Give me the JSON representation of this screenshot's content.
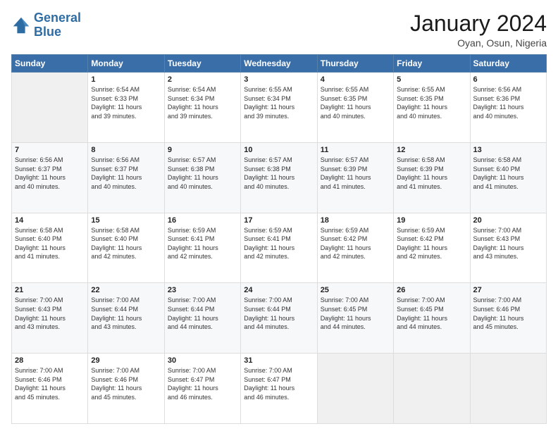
{
  "logo": {
    "line1": "General",
    "line2": "Blue"
  },
  "title": "January 2024",
  "subtitle": "Oyan, Osun, Nigeria",
  "days_of_week": [
    "Sunday",
    "Monday",
    "Tuesday",
    "Wednesday",
    "Thursday",
    "Friday",
    "Saturday"
  ],
  "weeks": [
    [
      {
        "day": "",
        "sunrise": "",
        "sunset": "",
        "daylight": ""
      },
      {
        "day": "1",
        "sunrise": "Sunrise: 6:54 AM",
        "sunset": "Sunset: 6:33 PM",
        "daylight": "Daylight: 11 hours and 39 minutes."
      },
      {
        "day": "2",
        "sunrise": "Sunrise: 6:54 AM",
        "sunset": "Sunset: 6:34 PM",
        "daylight": "Daylight: 11 hours and 39 minutes."
      },
      {
        "day": "3",
        "sunrise": "Sunrise: 6:55 AM",
        "sunset": "Sunset: 6:34 PM",
        "daylight": "Daylight: 11 hours and 39 minutes."
      },
      {
        "day": "4",
        "sunrise": "Sunrise: 6:55 AM",
        "sunset": "Sunset: 6:35 PM",
        "daylight": "Daylight: 11 hours and 40 minutes."
      },
      {
        "day": "5",
        "sunrise": "Sunrise: 6:55 AM",
        "sunset": "Sunset: 6:35 PM",
        "daylight": "Daylight: 11 hours and 40 minutes."
      },
      {
        "day": "6",
        "sunrise": "Sunrise: 6:56 AM",
        "sunset": "Sunset: 6:36 PM",
        "daylight": "Daylight: 11 hours and 40 minutes."
      }
    ],
    [
      {
        "day": "7",
        "sunrise": "Sunrise: 6:56 AM",
        "sunset": "Sunset: 6:37 PM",
        "daylight": "Daylight: 11 hours and 40 minutes."
      },
      {
        "day": "8",
        "sunrise": "Sunrise: 6:56 AM",
        "sunset": "Sunset: 6:37 PM",
        "daylight": "Daylight: 11 hours and 40 minutes."
      },
      {
        "day": "9",
        "sunrise": "Sunrise: 6:57 AM",
        "sunset": "Sunset: 6:38 PM",
        "daylight": "Daylight: 11 hours and 40 minutes."
      },
      {
        "day": "10",
        "sunrise": "Sunrise: 6:57 AM",
        "sunset": "Sunset: 6:38 PM",
        "daylight": "Daylight: 11 hours and 40 minutes."
      },
      {
        "day": "11",
        "sunrise": "Sunrise: 6:57 AM",
        "sunset": "Sunset: 6:39 PM",
        "daylight": "Daylight: 11 hours and 41 minutes."
      },
      {
        "day": "12",
        "sunrise": "Sunrise: 6:58 AM",
        "sunset": "Sunset: 6:39 PM",
        "daylight": "Daylight: 11 hours and 41 minutes."
      },
      {
        "day": "13",
        "sunrise": "Sunrise: 6:58 AM",
        "sunset": "Sunset: 6:40 PM",
        "daylight": "Daylight: 11 hours and 41 minutes."
      }
    ],
    [
      {
        "day": "14",
        "sunrise": "Sunrise: 6:58 AM",
        "sunset": "Sunset: 6:40 PM",
        "daylight": "Daylight: 11 hours and 41 minutes."
      },
      {
        "day": "15",
        "sunrise": "Sunrise: 6:58 AM",
        "sunset": "Sunset: 6:40 PM",
        "daylight": "Daylight: 11 hours and 42 minutes."
      },
      {
        "day": "16",
        "sunrise": "Sunrise: 6:59 AM",
        "sunset": "Sunset: 6:41 PM",
        "daylight": "Daylight: 11 hours and 42 minutes."
      },
      {
        "day": "17",
        "sunrise": "Sunrise: 6:59 AM",
        "sunset": "Sunset: 6:41 PM",
        "daylight": "Daylight: 11 hours and 42 minutes."
      },
      {
        "day": "18",
        "sunrise": "Sunrise: 6:59 AM",
        "sunset": "Sunset: 6:42 PM",
        "daylight": "Daylight: 11 hours and 42 minutes."
      },
      {
        "day": "19",
        "sunrise": "Sunrise: 6:59 AM",
        "sunset": "Sunset: 6:42 PM",
        "daylight": "Daylight: 11 hours and 42 minutes."
      },
      {
        "day": "20",
        "sunrise": "Sunrise: 7:00 AM",
        "sunset": "Sunset: 6:43 PM",
        "daylight": "Daylight: 11 hours and 43 minutes."
      }
    ],
    [
      {
        "day": "21",
        "sunrise": "Sunrise: 7:00 AM",
        "sunset": "Sunset: 6:43 PM",
        "daylight": "Daylight: 11 hours and 43 minutes."
      },
      {
        "day": "22",
        "sunrise": "Sunrise: 7:00 AM",
        "sunset": "Sunset: 6:44 PM",
        "daylight": "Daylight: 11 hours and 43 minutes."
      },
      {
        "day": "23",
        "sunrise": "Sunrise: 7:00 AM",
        "sunset": "Sunset: 6:44 PM",
        "daylight": "Daylight: 11 hours and 44 minutes."
      },
      {
        "day": "24",
        "sunrise": "Sunrise: 7:00 AM",
        "sunset": "Sunset: 6:44 PM",
        "daylight": "Daylight: 11 hours and 44 minutes."
      },
      {
        "day": "25",
        "sunrise": "Sunrise: 7:00 AM",
        "sunset": "Sunset: 6:45 PM",
        "daylight": "Daylight: 11 hours and 44 minutes."
      },
      {
        "day": "26",
        "sunrise": "Sunrise: 7:00 AM",
        "sunset": "Sunset: 6:45 PM",
        "daylight": "Daylight: 11 hours and 44 minutes."
      },
      {
        "day": "27",
        "sunrise": "Sunrise: 7:00 AM",
        "sunset": "Sunset: 6:46 PM",
        "daylight": "Daylight: 11 hours and 45 minutes."
      }
    ],
    [
      {
        "day": "28",
        "sunrise": "Sunrise: 7:00 AM",
        "sunset": "Sunset: 6:46 PM",
        "daylight": "Daylight: 11 hours and 45 minutes."
      },
      {
        "day": "29",
        "sunrise": "Sunrise: 7:00 AM",
        "sunset": "Sunset: 6:46 PM",
        "daylight": "Daylight: 11 hours and 45 minutes."
      },
      {
        "day": "30",
        "sunrise": "Sunrise: 7:00 AM",
        "sunset": "Sunset: 6:47 PM",
        "daylight": "Daylight: 11 hours and 46 minutes."
      },
      {
        "day": "31",
        "sunrise": "Sunrise: 7:00 AM",
        "sunset": "Sunset: 6:47 PM",
        "daylight": "Daylight: 11 hours and 46 minutes."
      },
      {
        "day": "",
        "sunrise": "",
        "sunset": "",
        "daylight": ""
      },
      {
        "day": "",
        "sunrise": "",
        "sunset": "",
        "daylight": ""
      },
      {
        "day": "",
        "sunrise": "",
        "sunset": "",
        "daylight": ""
      }
    ]
  ]
}
